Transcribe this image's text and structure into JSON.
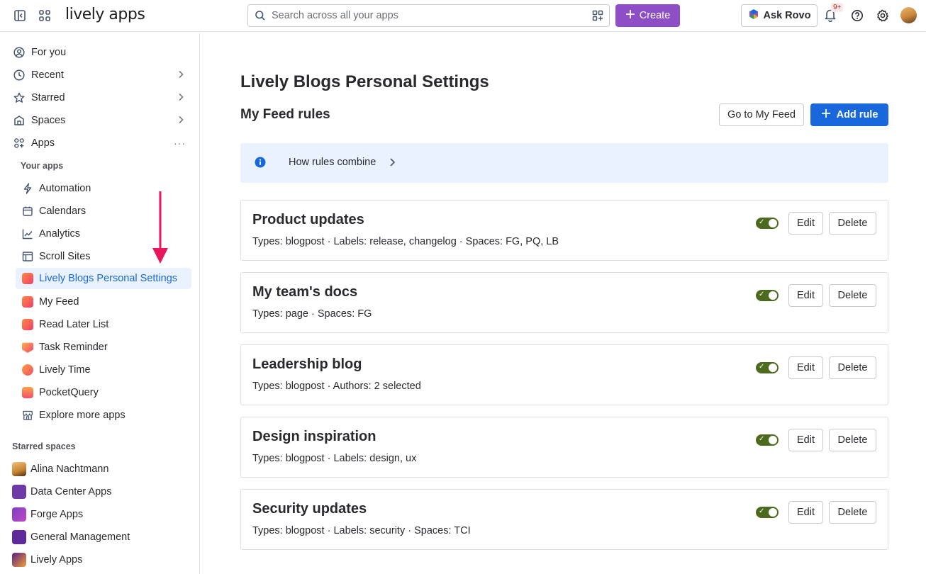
{
  "topbar": {
    "logo_text": "lively apps",
    "search_placeholder": "Search across all your apps",
    "create_label": "Create",
    "rovo_label": "Ask Rovo",
    "notification_badge": "9+"
  },
  "sidebar": {
    "items": [
      {
        "label": "For you",
        "icon": "person-circle-icon"
      },
      {
        "label": "Recent",
        "icon": "clock-icon"
      },
      {
        "label": "Starred",
        "icon": "star-icon"
      },
      {
        "label": "Spaces",
        "icon": "spaces-icon"
      },
      {
        "label": "Apps",
        "icon": "apps-icon"
      }
    ],
    "your_apps_label": "Your apps",
    "apps": [
      {
        "label": "Automation",
        "icon": "lightning-icon"
      },
      {
        "label": "Calendars",
        "icon": "calendar-icon"
      },
      {
        "label": "Analytics",
        "icon": "line-chart-icon"
      },
      {
        "label": "Scroll Sites",
        "icon": "window-icon"
      },
      {
        "label": "Lively Blogs Personal Settings",
        "icon": "lively-blogs-icon",
        "active": true
      },
      {
        "label": "My Feed",
        "icon": "lively-blogs-icon"
      },
      {
        "label": "Read Later List",
        "icon": "lively-blogs-icon"
      },
      {
        "label": "Task Reminder",
        "icon": "task-reminder-icon"
      },
      {
        "label": "Lively Time",
        "icon": "lively-time-icon"
      },
      {
        "label": "PocketQuery",
        "icon": "pocketquery-icon"
      },
      {
        "label": "Explore more apps",
        "icon": "store-icon"
      }
    ],
    "starred_spaces_label": "Starred spaces",
    "spaces": [
      {
        "label": "Alina Nachtmann",
        "color": "#e3a35a"
      },
      {
        "label": "Data Center Apps",
        "color": "#6e3aa8"
      },
      {
        "label": "Forge Apps",
        "color": "#7b3fc4"
      },
      {
        "label": "General Management",
        "color": "#5e2a9a"
      },
      {
        "label": "Lively Apps",
        "color": "#5a1f8a"
      }
    ]
  },
  "main": {
    "page_title": "Lively Blogs Personal Settings",
    "section_title": "My Feed rules",
    "go_to_feed_label": "Go to My Feed",
    "add_rule_label": "Add rule",
    "info_text": "How rules combine",
    "edit_label": "Edit",
    "delete_label": "Delete",
    "rules": [
      {
        "title": "Product updates",
        "description": "Types: blogpost · Labels: release, changelog · Spaces: FG, PQ, LB",
        "enabled": true
      },
      {
        "title": "My team's docs",
        "description": "Types: page · Spaces: FG",
        "enabled": true
      },
      {
        "title": "Leadership blog",
        "description": "Types: blogpost · Authors: 2 selected",
        "enabled": true
      },
      {
        "title": "Design inspiration",
        "description": "Types: blogpost · Labels: design, ux",
        "enabled": true
      },
      {
        "title": "Security updates",
        "description": "Types: blogpost · Labels: security · Spaces: TCI",
        "enabled": true
      }
    ]
  },
  "colors": {
    "accent_blue": "#1868db",
    "create_purple": "#8e4ec6",
    "toggle_green": "#4c6b1f",
    "arrow_pink": "#e8175d"
  }
}
